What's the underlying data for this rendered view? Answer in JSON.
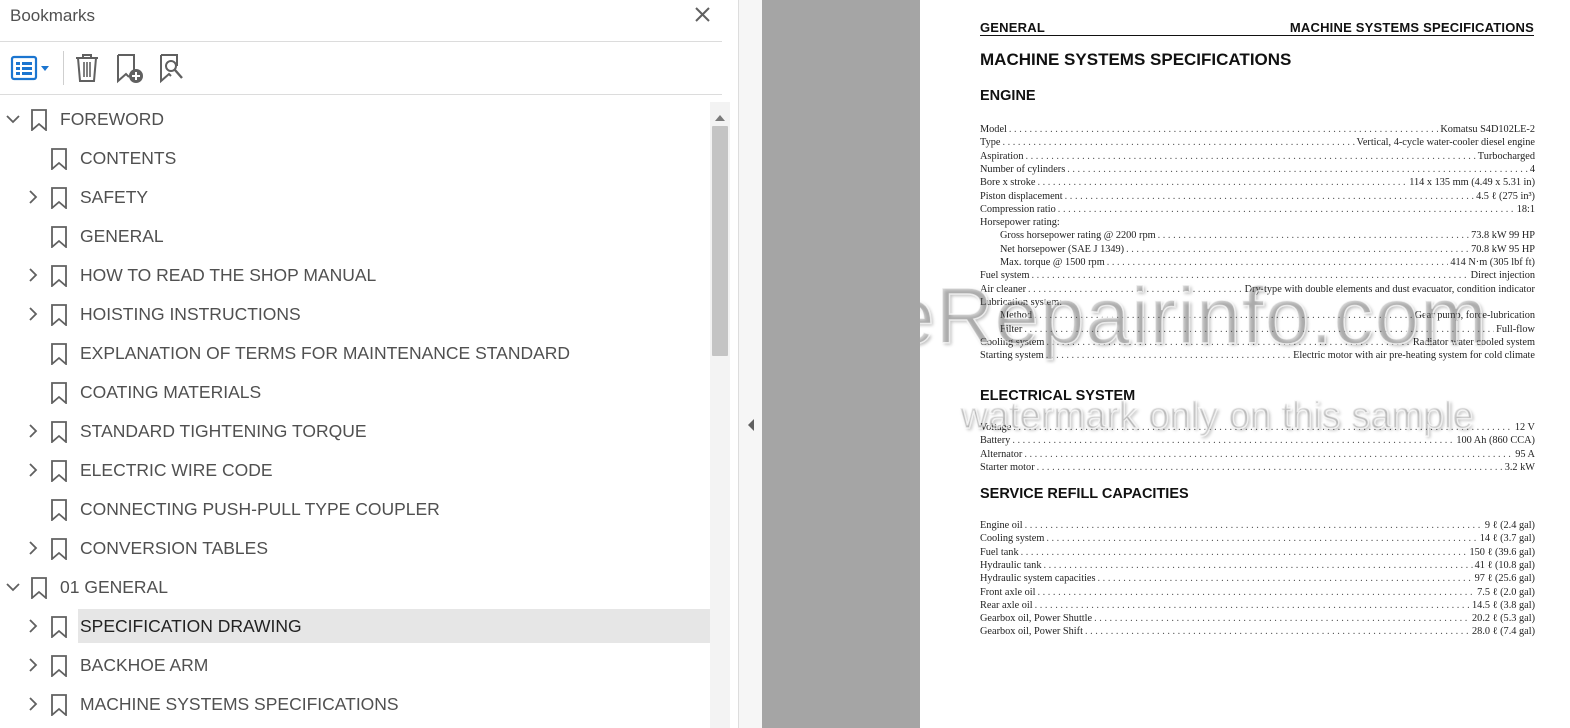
{
  "bookmarks_panel": {
    "title": "Bookmarks",
    "close_icon": "close-icon",
    "toolbar": {
      "options_icon": "bookmark-options-icon",
      "delete_icon": "trash-icon",
      "add_icon": "add-bookmark-icon",
      "find_icon": "find-bookmark-icon"
    },
    "items": [
      {
        "label": "FOREWORD",
        "level": 0,
        "expander": "expanded"
      },
      {
        "label": "CONTENTS",
        "level": 1,
        "expander": "none"
      },
      {
        "label": "SAFETY",
        "level": 1,
        "expander": "collapsed"
      },
      {
        "label": "GENERAL",
        "level": 1,
        "expander": "none"
      },
      {
        "label": "HOW TO READ THE SHOP MANUAL",
        "level": 1,
        "expander": "collapsed"
      },
      {
        "label": "HOISTING INSTRUCTIONS",
        "level": 1,
        "expander": "collapsed"
      },
      {
        "label": "EXPLANATION OF TERMS FOR MAINTENANCE STANDARD",
        "level": 1,
        "expander": "none"
      },
      {
        "label": "COATING MATERIALS",
        "level": 1,
        "expander": "none"
      },
      {
        "label": "STANDARD TIGHTENING TORQUE",
        "level": 1,
        "expander": "collapsed"
      },
      {
        "label": "ELECTRIC WIRE CODE",
        "level": 1,
        "expander": "collapsed"
      },
      {
        "label": "CONNECTING PUSH-PULL TYPE COUPLER",
        "level": 1,
        "expander": "none"
      },
      {
        "label": "CONVERSION TABLES",
        "level": 1,
        "expander": "collapsed"
      },
      {
        "label": "01 GENERAL",
        "level": 0,
        "expander": "expanded"
      },
      {
        "label": "SPECIFICATION DRAWING",
        "level": 1,
        "expander": "collapsed",
        "selected": true
      },
      {
        "label": "BACKHOE ARM",
        "level": 1,
        "expander": "collapsed"
      },
      {
        "label": "MACHINE SYSTEMS SPECIFICATIONS",
        "level": 1,
        "expander": "collapsed"
      }
    ]
  },
  "document": {
    "header_left": "GENERAL",
    "header_right": "MACHINE SYSTEMS SPECIFICATIONS",
    "title": "MACHINE SYSTEMS SPECIFICATIONS",
    "sections": {
      "engine": "ENGINE",
      "electrical": "ELECTRICAL SYSTEM",
      "refill": "SERVICE REFILL CAPACITIES"
    },
    "engine_specs": [
      {
        "k": "Model",
        "v": "Komatsu S4D102LE-2"
      },
      {
        "k": "Type",
        "v": "Vertical, 4-cycle water-cooler diesel engine"
      },
      {
        "k": "Aspiration",
        "v": "Turbocharged"
      },
      {
        "k": "Number of cylinders",
        "v": "4"
      },
      {
        "k": "Bore x stroke",
        "v": "114 x 135 mm (4.49 x 5.31 in)"
      },
      {
        "k": "Piston displacement",
        "v": "4.5 ℓ (275 in³)"
      },
      {
        "k": "Compression ratio",
        "v": "18:1"
      },
      {
        "k": "Horsepower rating:",
        "v": "",
        "label_only": true
      },
      {
        "k": "Gross horsepower rating @ 2200 rpm",
        "v": "73.8 kW 99 HP",
        "indent": true
      },
      {
        "k": "Net horsepower (SAE J 1349)",
        "v": "70.8 kW 95 HP",
        "indent": true
      },
      {
        "k": "Max. torque @ 1500 rpm",
        "v": "414 N·m (305 lbf ft)",
        "indent": true
      },
      {
        "k": "Fuel system",
        "v": "Direct injection"
      },
      {
        "k": "Air cleaner",
        "v": "Dry-type with double elements and dust evacuator, condition indicator"
      },
      {
        "k": "Lubrication system:",
        "v": "",
        "label_only": true
      },
      {
        "k": "Method",
        "v": "Gear pump, force-lubrication",
        "indent": true
      },
      {
        "k": "Filter",
        "v": "Full-flow",
        "indent": true
      },
      {
        "k": "Cooling system",
        "v": "Radiator water cooled system"
      },
      {
        "k": "Starting system",
        "v": "Electric motor with air pre-heating system for cold climate"
      }
    ],
    "electrical_specs": [
      {
        "k": "Voltage",
        "v": "12 V"
      },
      {
        "k": "Battery",
        "v": "100 Ah (860 CCA)"
      },
      {
        "k": "Alternator",
        "v": "95 A"
      },
      {
        "k": "Starter motor",
        "v": "3.2 kW"
      }
    ],
    "refill_specs": [
      {
        "k": "Engine oil",
        "v": "9 ℓ (2.4 gal)"
      },
      {
        "k": "Cooling system",
        "v": "14 ℓ (3.7 gal)"
      },
      {
        "k": "Fuel tank",
        "v": "150 ℓ (39.6 gal)"
      },
      {
        "k": "Hydraulic tank",
        "v": "41 ℓ (10.8 gal)"
      },
      {
        "k": "Hydraulic system capacities",
        "v": "97 ℓ (25.6 gal)"
      },
      {
        "k": "Front axle oil",
        "v": "7.5 ℓ (2.0 gal)"
      },
      {
        "k": "Rear axle oil",
        "v": "14.5 ℓ (3.8 gal)"
      },
      {
        "k": "Gearbox oil, Power Shuttle",
        "v": "20.2 ℓ (5.3 gal)"
      },
      {
        "k": "Gearbox oil, Power Shift",
        "v": "28.0 ℓ (7.4 gal)"
      }
    ],
    "watermark_logo": "eRepairinfo.com",
    "watermark_text": "watermark only on this sample"
  }
}
